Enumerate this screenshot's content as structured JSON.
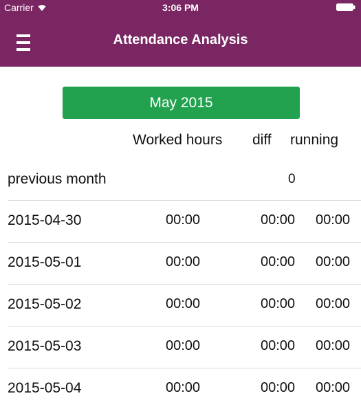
{
  "status_bar": {
    "carrier": "Carrier",
    "time": "3:06 PM"
  },
  "nav": {
    "title": "Attendance Analysis",
    "menu_icon": "hamburger-menu-icon"
  },
  "month_selector": {
    "label": "May 2015"
  },
  "table": {
    "headers": {
      "worked": "Worked hours",
      "diff": "diff",
      "running": "running"
    },
    "previous_month": {
      "label": "previous month",
      "value": "0"
    },
    "rows": [
      {
        "date": "2015-04-30",
        "worked": "00:00",
        "diff": "00:00",
        "running": "00:00"
      },
      {
        "date": "2015-05-01",
        "worked": "00:00",
        "diff": "00:00",
        "running": "00:00"
      },
      {
        "date": "2015-05-02",
        "worked": "00:00",
        "diff": "00:00",
        "running": "00:00"
      },
      {
        "date": "2015-05-03",
        "worked": "00:00",
        "diff": "00:00",
        "running": "00:00"
      },
      {
        "date": "2015-05-04",
        "worked": "00:00",
        "diff": "00:00",
        "running": "00:00"
      }
    ]
  },
  "colors": {
    "nav_background": "#7a2663",
    "button_green": "#22a24f",
    "separator": "#d9d9d9"
  }
}
